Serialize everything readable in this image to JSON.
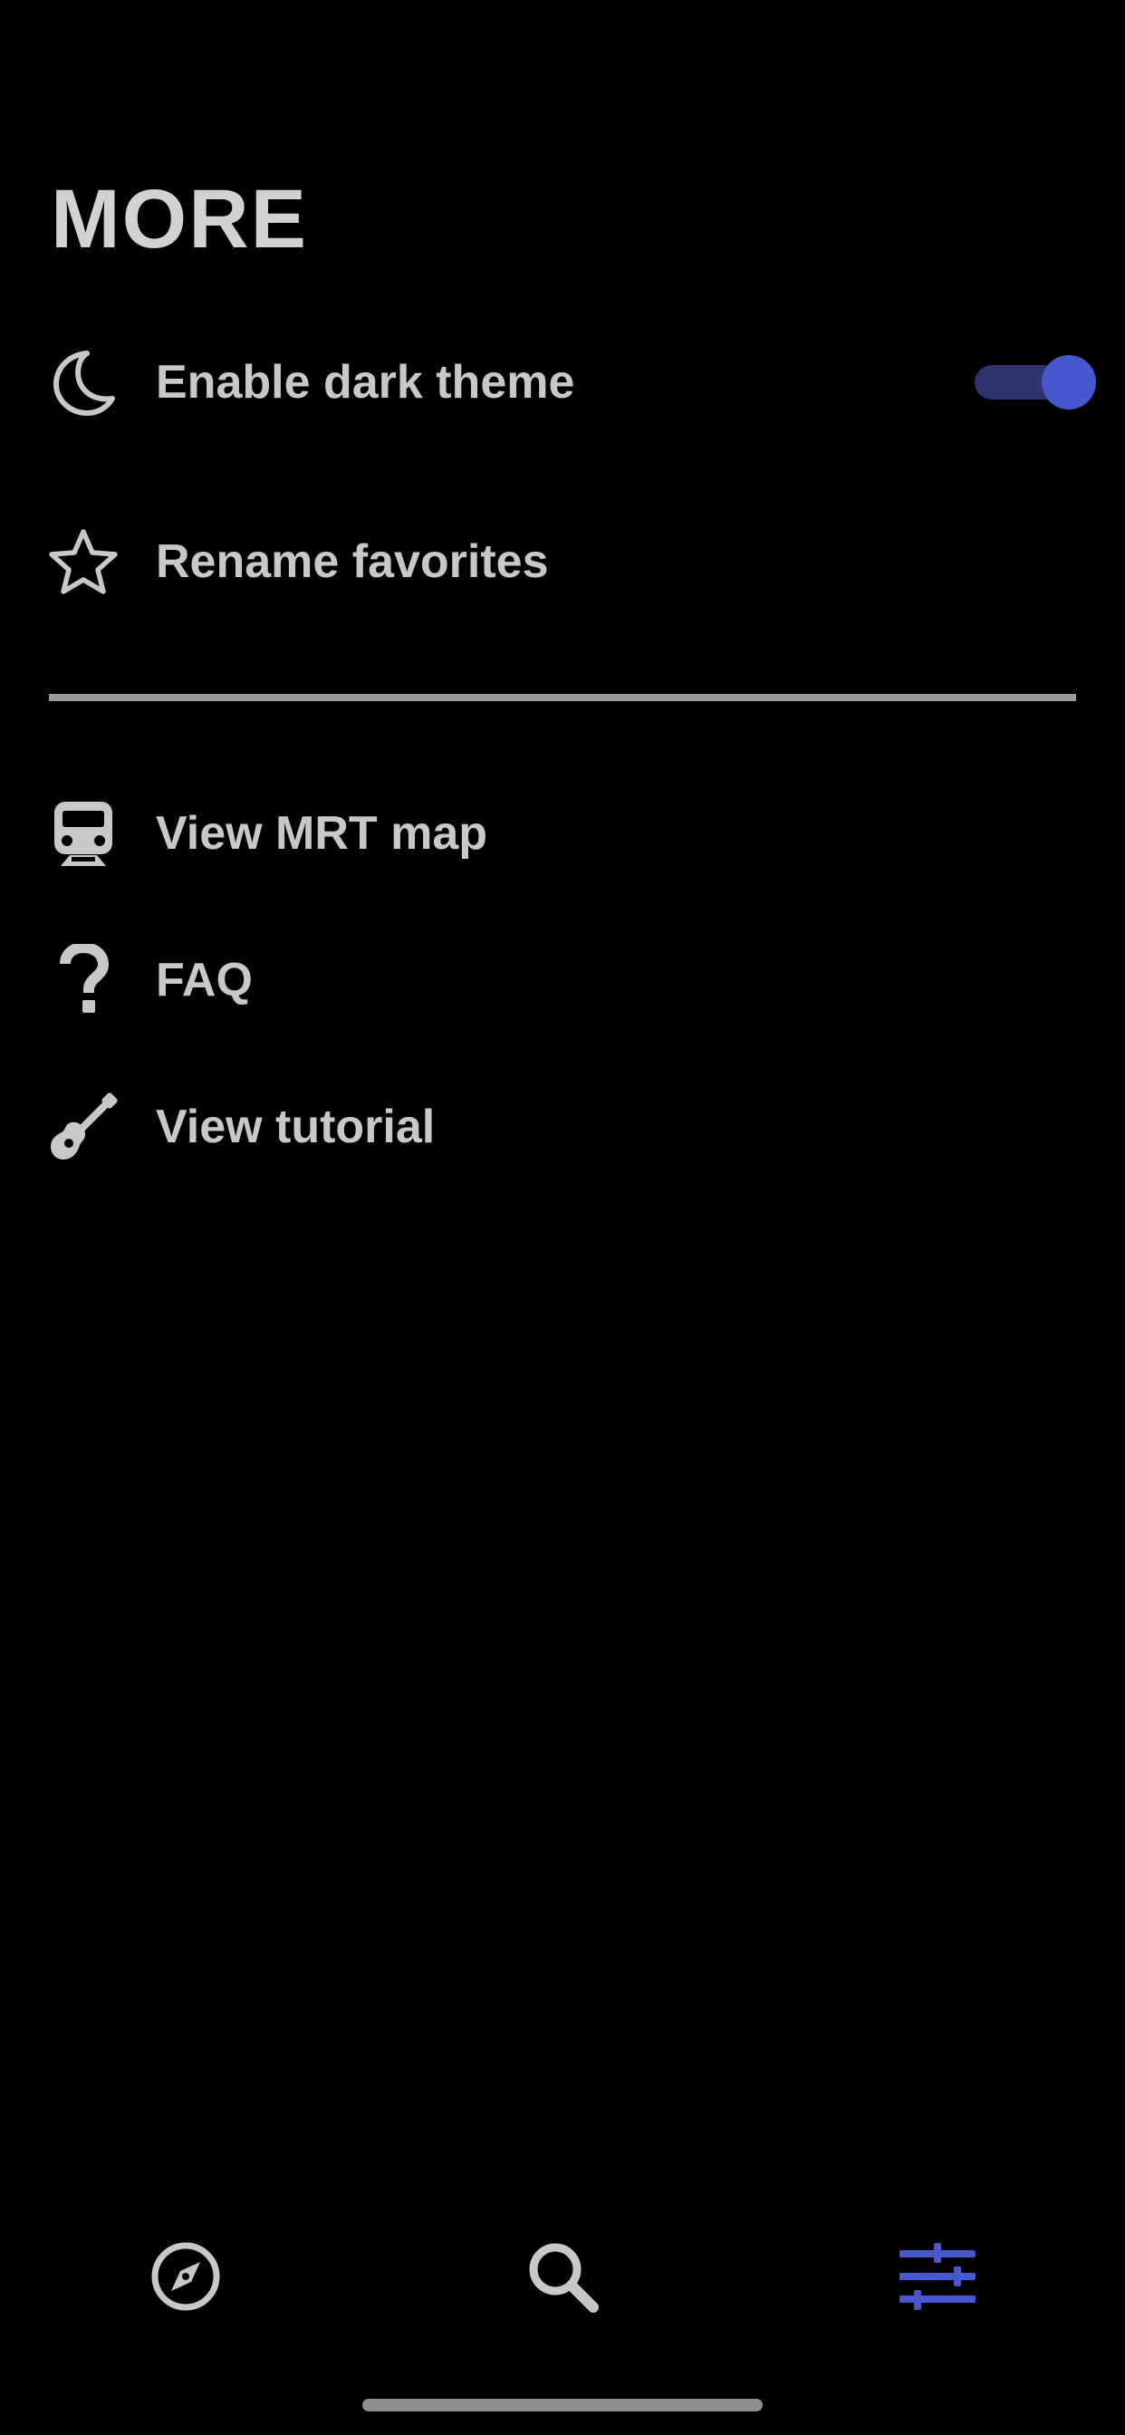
{
  "header": {
    "title": "MORE"
  },
  "settings": {
    "dark_theme": {
      "label": "Enable dark theme",
      "icon": "moon-icon",
      "enabled": true
    },
    "rename_favorites": {
      "label": "Rename favorites",
      "icon": "star-icon"
    }
  },
  "links": [
    {
      "label": "View MRT map",
      "icon": "train-icon"
    },
    {
      "label": "FAQ",
      "icon": "question-icon"
    },
    {
      "label": "View tutorial",
      "icon": "guitar-icon"
    }
  ],
  "tab_bar": {
    "tabs": [
      {
        "icon": "compass-icon",
        "active": false
      },
      {
        "icon": "search-icon",
        "active": false
      },
      {
        "icon": "sliders-icon",
        "active": true
      }
    ]
  },
  "colors": {
    "background": "#000000",
    "text": "#c8c8c8",
    "accent": "#4758cf",
    "toggle_track": "#2d3470",
    "divider": "#9a9a9a",
    "inactive_icon": "#c8c8c8"
  }
}
